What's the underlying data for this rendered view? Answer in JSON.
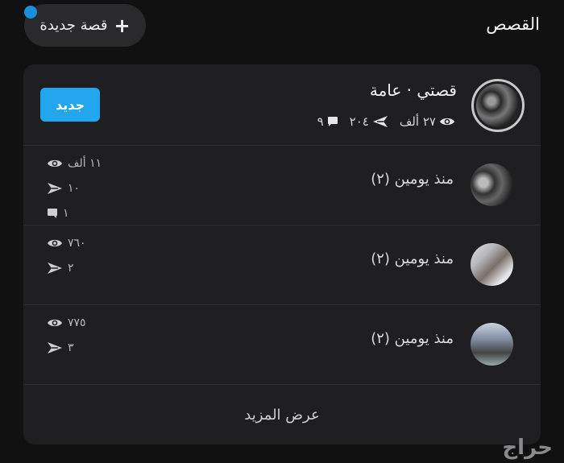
{
  "header": {
    "title": "القصص",
    "new_story_label": "قصة جديدة"
  },
  "main_story": {
    "title": "قصتي · عامة",
    "views": "٢٧ ألف",
    "shares": "٢٠٤",
    "comments": "٩",
    "badge": "جديد"
  },
  "stories": [
    {
      "time": "منذ يومين (٢)",
      "views": "١١ ألف",
      "shares": "١٠",
      "comments": "١"
    },
    {
      "time": "منذ يومين (٢)",
      "views": "٧٦٠",
      "shares": "٢"
    },
    {
      "time": "منذ يومين (٢)",
      "views": "٧٧٥",
      "shares": "٣"
    }
  ],
  "show_more_label": "عرض المزيد",
  "watermark": "حراج",
  "colors": {
    "accent": "#22a7ee",
    "notification_dot": "#1a8fe0",
    "background": "#111112",
    "card": "#1f1f21"
  }
}
